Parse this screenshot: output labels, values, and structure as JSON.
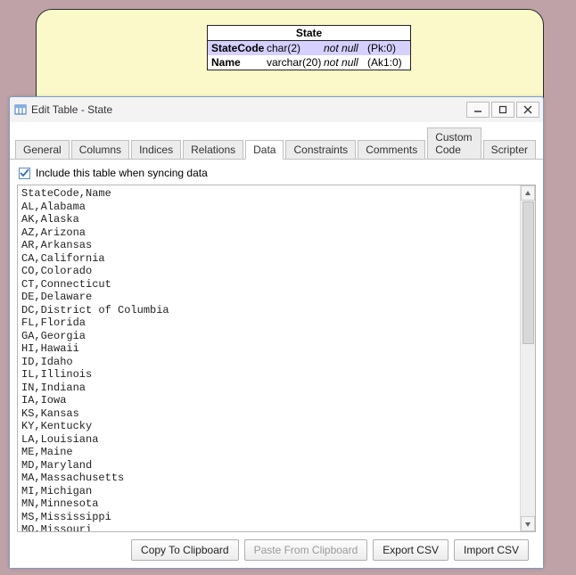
{
  "erd": {
    "title": "State",
    "rows": [
      {
        "name": "StateCode",
        "type": "char(2)",
        "nullable": "not null",
        "key": "(Pk:0)"
      },
      {
        "name": "Name",
        "type": "varchar(20)",
        "nullable": "not null",
        "key": "(Ak1:0)"
      }
    ]
  },
  "window": {
    "title": "Edit Table - State"
  },
  "tabs": [
    {
      "id": "general",
      "label": "General"
    },
    {
      "id": "columns",
      "label": "Columns"
    },
    {
      "id": "indices",
      "label": "Indices"
    },
    {
      "id": "relations",
      "label": "Relations"
    },
    {
      "id": "data",
      "label": "Data",
      "active": true
    },
    {
      "id": "constraints",
      "label": "Constraints"
    },
    {
      "id": "comments",
      "label": "Comments"
    },
    {
      "id": "customcode",
      "label": "Custom Code"
    },
    {
      "id": "scripter",
      "label": "Scripter"
    }
  ],
  "include_checkbox": {
    "checked": true,
    "label": "Include this table when syncing data"
  },
  "data_text": "StateCode,Name\nAL,Alabama\nAK,Alaska\nAZ,Arizona\nAR,Arkansas\nCA,California\nCO,Colorado\nCT,Connecticut\nDE,Delaware\nDC,District of Columbia\nFL,Florida\nGA,Georgia\nHI,Hawaii\nID,Idaho\nIL,Illinois\nIN,Indiana\nIA,Iowa\nKS,Kansas\nKY,Kentucky\nLA,Louisiana\nME,Maine\nMD,Maryland\nMA,Massachusetts\nMI,Michigan\nMN,Minnesota\nMS,Mississippi\nMO,Missouri\nMT,Montana",
  "buttons": {
    "copy": "Copy To Clipboard",
    "paste": "Paste From Clipboard",
    "export": "Export CSV",
    "import": "Import CSV"
  }
}
